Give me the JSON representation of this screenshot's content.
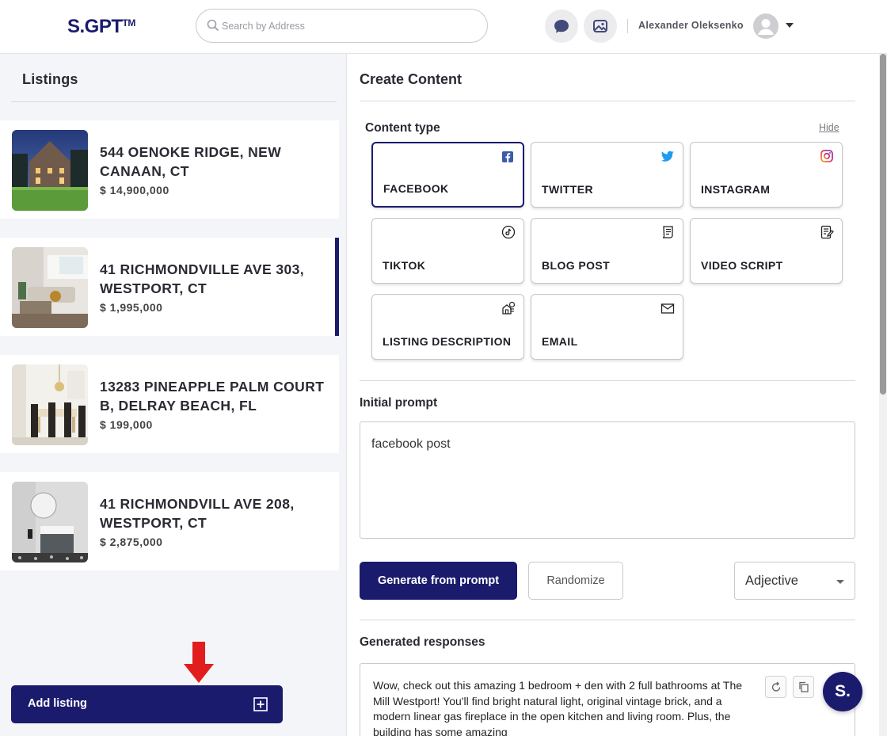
{
  "header": {
    "logo": "S.GPT",
    "logo_tm": "TM",
    "search_placeholder": "Search by Address",
    "user_name": "Alexander Oleksenko"
  },
  "listings": {
    "title": "Listings",
    "items": [
      {
        "address": "544 OENOKE RIDGE, NEW CANAAN, CT",
        "price": "$ 14,900,000",
        "active": false
      },
      {
        "address": "41 RICHMONDVILLE AVE 303, WESTPORT, CT",
        "price": "$ 1,995,000",
        "active": true
      },
      {
        "address": "13283 PINEAPPLE PALM COURT B, DELRAY BEACH, FL",
        "price": "$ 199,000",
        "active": false
      },
      {
        "address": "41 RICHMONDVILL AVE 208, WESTPORT, CT",
        "price": "$ 2,875,000",
        "active": false
      }
    ],
    "add_label": "Add listing"
  },
  "content": {
    "title": "Create Content",
    "content_type_label": "Content type",
    "hide_label": "Hide",
    "types": [
      {
        "label": "FACEBOOK",
        "icon": "facebook-icon",
        "selected": true
      },
      {
        "label": "TWITTER",
        "icon": "twitter-icon",
        "selected": false
      },
      {
        "label": "INSTAGRAM",
        "icon": "instagram-icon",
        "selected": false
      },
      {
        "label": "TIKTOK",
        "icon": "tiktok-icon",
        "selected": false
      },
      {
        "label": "BLOG POST",
        "icon": "blog-post-icon",
        "selected": false
      },
      {
        "label": "VIDEO SCRIPT",
        "icon": "video-script-icon",
        "selected": false
      },
      {
        "label": "LISTING DESCRIPTION",
        "icon": "listing-description-icon",
        "selected": false
      },
      {
        "label": "EMAIL",
        "icon": "email-icon",
        "selected": false
      }
    ],
    "initial_prompt_label": "Initial prompt",
    "prompt_value": "facebook post",
    "generate_label": "Generate from prompt",
    "randomize_label": "Randomize",
    "adjective_value": "Adjective",
    "generated_label": "Generated responses",
    "response_text": "Wow, check out this amazing 1 bedroom + den with 2 full bathrooms at The Mill Westport! You'll find bright natural light, original vintage brick, and a modern linear gas fireplace in the open kitchen and living room. Plus, the building has some amazing",
    "fab_label": "S."
  },
  "colors": {
    "brand": "#1b1b6e",
    "arrow": "#e11d1d"
  }
}
